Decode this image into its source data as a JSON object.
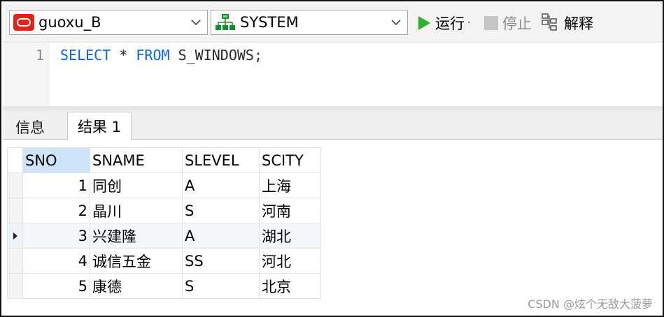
{
  "toolbar": {
    "connection": "guoxu_B",
    "schema": "SYSTEM",
    "run_label": "运行",
    "stop_label": "停止",
    "explain_label": "解释"
  },
  "editor": {
    "line_number": "1",
    "kw_select": "SELECT",
    "star": " * ",
    "kw_from": "FROM",
    "table": " S_WINDOWS;"
  },
  "tabs": [
    {
      "label": "信息"
    },
    {
      "label": "结果 1"
    }
  ],
  "grid": {
    "columns": [
      "SNO",
      "SNAME",
      "SLEVEL",
      "SCITY"
    ],
    "rows": [
      {
        "sno": "1",
        "sname": "同创",
        "slevel": "A",
        "scity": "上海"
      },
      {
        "sno": "2",
        "sname": "晶川",
        "slevel": "S",
        "scity": "河南"
      },
      {
        "sno": "3",
        "sname": "兴建隆",
        "slevel": "A",
        "scity": "湖北"
      },
      {
        "sno": "4",
        "sname": "诚信五金",
        "slevel": "SS",
        "scity": "河北"
      },
      {
        "sno": "5",
        "sname": "康德",
        "slevel": "S",
        "scity": "北京"
      }
    ],
    "current_row": 3
  },
  "watermark": "CSDN @炫个无敌大菠萝",
  "colors": {
    "keyword": "#0b64d8",
    "run_green": "#2bb32b",
    "oracle_red": "#e2231a",
    "schema_green": "#1a8a2e",
    "header_selected": "#cfe3f8"
  },
  "icons": [
    "oracle-icon",
    "schema-icon",
    "chevron-down-icon",
    "run-icon",
    "stop-icon",
    "explain-icon",
    "row-pointer-icon"
  ]
}
